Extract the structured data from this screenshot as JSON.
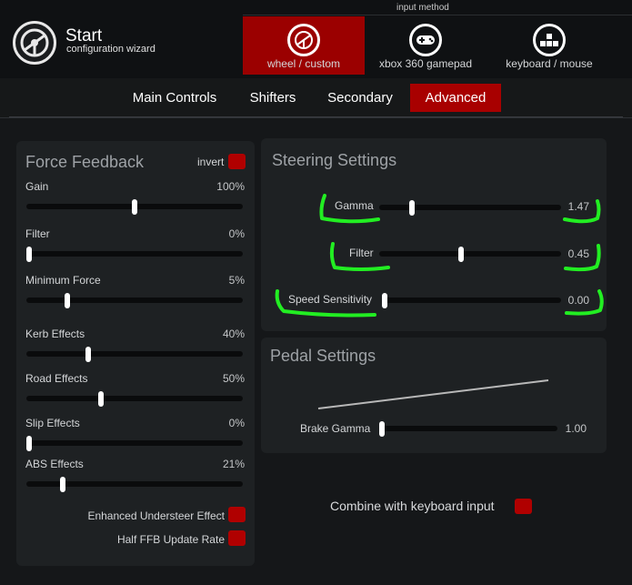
{
  "header": {
    "title": "Start",
    "subtitle": "configuration wizard",
    "input_method_label": "input method",
    "input_methods": [
      {
        "label": "wheel / custom",
        "icon": "steering-wheel-icon",
        "active": true
      },
      {
        "label": "xbox 360 gamepad",
        "icon": "gamepad-icon",
        "active": false
      },
      {
        "label": "keyboard / mouse",
        "icon": "keyboard-icon",
        "active": false
      }
    ]
  },
  "tabs": [
    {
      "label": "Main Controls",
      "active": false
    },
    {
      "label": "Shifters",
      "active": false
    },
    {
      "label": "Secondary",
      "active": false
    },
    {
      "label": "Advanced",
      "active": true
    }
  ],
  "force_feedback": {
    "title": "Force Feedback",
    "invert_label": "invert",
    "sliders": [
      {
        "label": "Gain",
        "value": "100%",
        "level": 0.5
      },
      {
        "label": "Filter",
        "value": "0%",
        "level": 0.0
      },
      {
        "label": "Minimum Force",
        "value": "5%",
        "level": 0.18
      },
      {
        "label": "Kerb Effects",
        "value": "40%",
        "level": 0.28
      },
      {
        "label": "Road Effects",
        "value": "50%",
        "level": 0.34
      },
      {
        "label": "Slip Effects",
        "value": "0%",
        "level": 0.0
      },
      {
        "label": "ABS Effects",
        "value": "21%",
        "level": 0.16
      }
    ],
    "enhanced_understeer_label": "Enhanced Understeer Effect",
    "half_ffb_label": "Half FFB Update Rate"
  },
  "steering": {
    "title": "Steering Settings",
    "sliders": [
      {
        "label": "Gamma",
        "value": "1.47",
        "level": 0.17
      },
      {
        "label": "Filter",
        "value": "0.45",
        "level": 0.45
      },
      {
        "label": "Speed Sensitivity",
        "value": "0.00",
        "level": 0.0
      }
    ]
  },
  "pedal": {
    "title": "Pedal Settings",
    "brake_gamma_label": "Brake Gamma",
    "brake_gamma_value": "1.00",
    "brake_gamma_level": 0.0
  },
  "combine_keyboard_label": "Combine with keyboard input",
  "colors": {
    "accent": "#a80000",
    "annotation": "#22ee22"
  }
}
